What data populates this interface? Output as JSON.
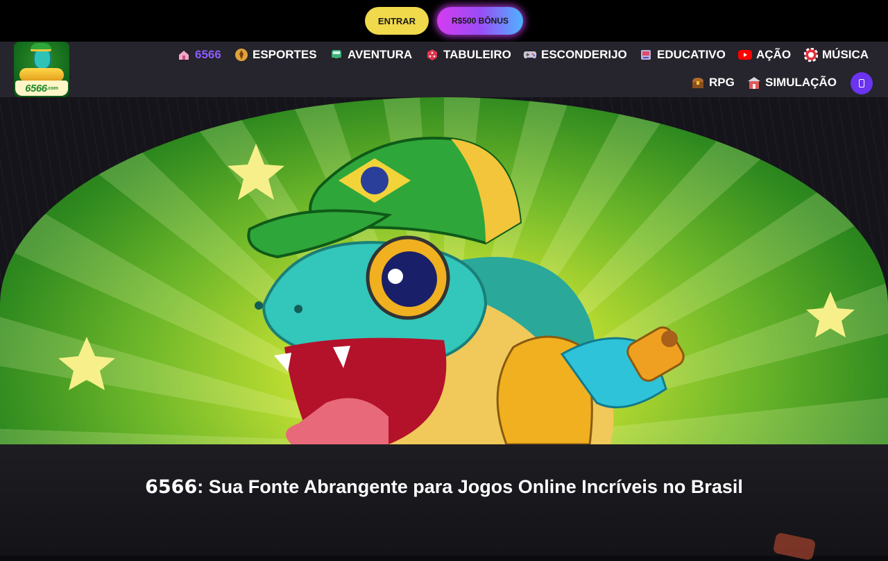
{
  "header": {
    "login_label": "ENTRAR",
    "bonus_label": "R$500 BÔNUS"
  },
  "logo": {
    "text": "6566",
    "suffix": ".com"
  },
  "nav": {
    "items": [
      {
        "label": "6566",
        "icon": "home-icon",
        "active": true
      },
      {
        "label": "ESPORTES",
        "icon": "sports-ball-icon"
      },
      {
        "label": "AVENTURA",
        "icon": "bus-icon"
      },
      {
        "label": "TABULEIRO",
        "icon": "dice-icon"
      },
      {
        "label": "ESCONDERIJO",
        "icon": "gamepad-icon"
      },
      {
        "label": "EDUCATIVO",
        "icon": "arcade-icon"
      },
      {
        "label": "AÇÃO",
        "icon": "youtube-play-icon"
      },
      {
        "label": "MÚSICA",
        "icon": "poker-chip-icon"
      },
      {
        "label": "RPG",
        "icon": "treasure-chest-icon"
      },
      {
        "label": "SIMULAÇÃO",
        "icon": "building-icon"
      }
    ],
    "menu_icon": "menu-icon"
  },
  "hero": {
    "headline_brand": "6566",
    "headline_rest": ": Sua Fonte Abrangente para Jogos Online Incríveis no Brasil"
  },
  "colors": {
    "accent_purple": "#8c5cff",
    "login_yellow": "#f0d94a",
    "nav_background": "#26242c",
    "menu_button": "#6a34f0"
  }
}
